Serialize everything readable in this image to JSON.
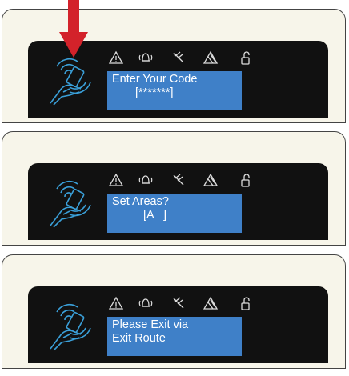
{
  "icons": [
    "warning-icon",
    "alarm-bell-icon",
    "no-tamper-icon",
    "fault-icon",
    "unlocked-icon",
    "contactless-card-icon"
  ],
  "colors": {
    "lcd": "#3f80c8",
    "bezel": "#111111",
    "keypad": "#f7f5ea",
    "arrow": "#d3222a"
  },
  "panels": [
    {
      "line1": "Enter Your Code",
      "line2": "[*******]"
    },
    {
      "line1": "Set Areas?",
      "line2": "[A   ]"
    },
    {
      "line1": "Please Exit via",
      "line2": "Exit Route"
    }
  ]
}
